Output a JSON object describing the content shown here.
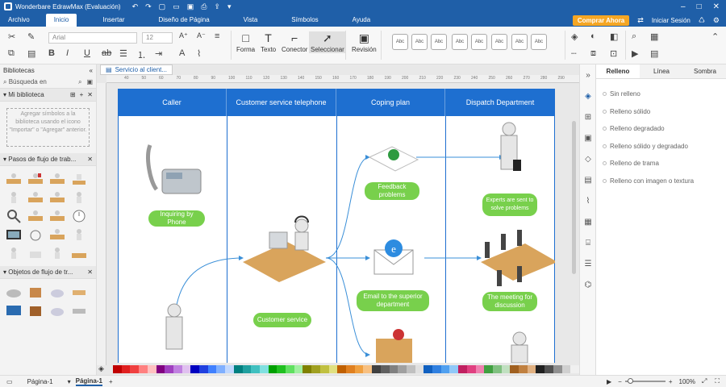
{
  "titlebar": {
    "app_title": "Wonderbare EdrawMax (Evaluación)"
  },
  "menubar": {
    "tabs": [
      "Archivo",
      "Inicio",
      "Insertar",
      "Diseño de Página",
      "Vista",
      "Símbolos",
      "Ayuda"
    ],
    "buy_label": "Comprar Ahora",
    "login_label": "Iniciar Sesión"
  },
  "ribbon": {
    "font_name": "Arial",
    "font_size": "12",
    "tools": [
      "Forma",
      "Texto",
      "Conector",
      "Seleccionar",
      "Revisión"
    ],
    "style_label": "Abc"
  },
  "left_panel": {
    "libraries_label": "Bibliotecas",
    "search_placeholder": "Búsqueda en",
    "my_library": "Mi biblioteca",
    "hint": "Agregar símbolos a la biblioteca usando el icono \"Importar\" o \"Agregar\" anterior.",
    "section1": "Pasos de flujo de trab...",
    "section2": "Objetos de flujo de tr..."
  },
  "canvas": {
    "doc_tab": "Servicio al client...",
    "ruler_marks": [
      "40",
      "50",
      "60",
      "70",
      "80",
      "90",
      "100",
      "110",
      "120",
      "130",
      "140",
      "150",
      "160",
      "170",
      "180",
      "190",
      "200",
      "210",
      "220",
      "230",
      "240",
      "250",
      "260",
      "270",
      "280",
      "290"
    ],
    "lanes": [
      "Caller",
      "Customer service telephone",
      "Coping plan",
      "Dispatch Department"
    ],
    "labels": {
      "inquiring": "Inquiring by Phone",
      "customer_service": "Customer service",
      "feedback": "Feedback problems",
      "experts": "Experts are sent to solve problems",
      "email": "Email to the superior department",
      "meeting": "The meeting for discussion"
    }
  },
  "right_panel": {
    "tabs": [
      "Relleno",
      "Línea",
      "Sombra"
    ],
    "options": [
      "Sin relleno",
      "Relleno sólido",
      "Relleno degradado",
      "Relleno sólido y degradado",
      "Relleno de trama",
      "Relleno con imagen o textura"
    ]
  },
  "statusbar": {
    "page_tab": "Página-1",
    "page_active": "Página-1",
    "zoom": "100%"
  },
  "colors": {
    "brand": "#1f5fa8",
    "lane_header": "#1e6fd0",
    "pill": "#78d04c",
    "buy": "#f5a623"
  }
}
